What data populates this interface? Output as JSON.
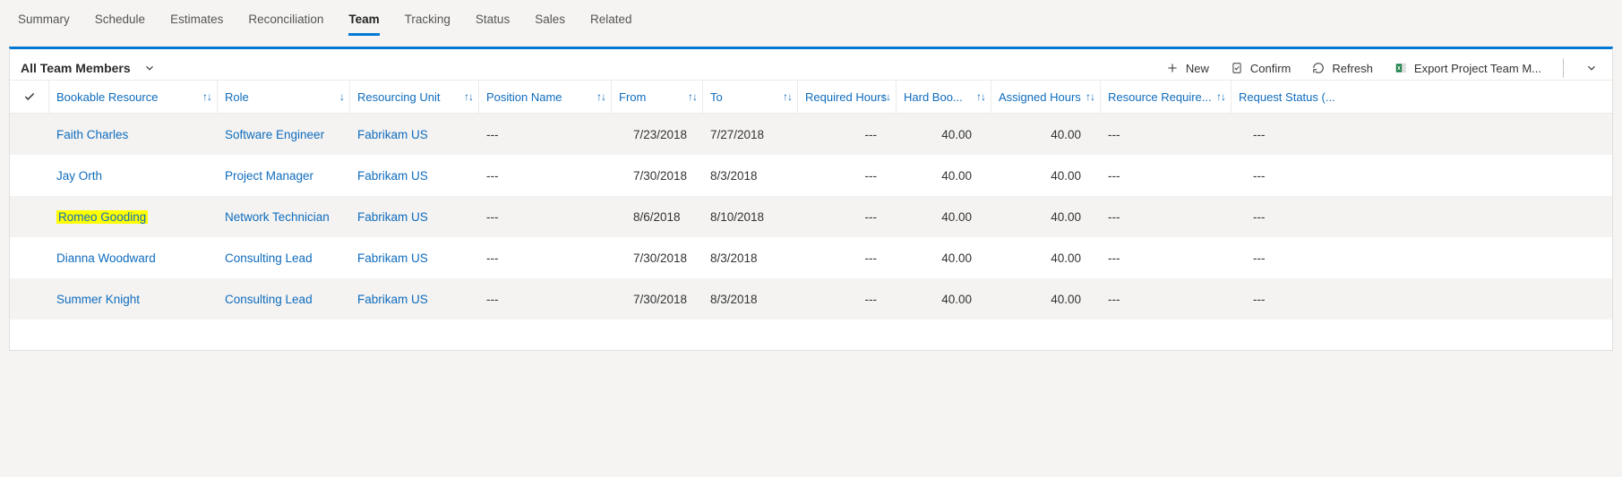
{
  "tabs": {
    "items": [
      {
        "label": "Summary"
      },
      {
        "label": "Schedule"
      },
      {
        "label": "Estimates"
      },
      {
        "label": "Reconciliation"
      },
      {
        "label": "Team"
      },
      {
        "label": "Tracking"
      },
      {
        "label": "Status"
      },
      {
        "label": "Sales"
      },
      {
        "label": "Related"
      }
    ],
    "active_index": 4
  },
  "view": {
    "name": "All Team Members"
  },
  "commands": {
    "new": "New",
    "confirm": "Confirm",
    "refresh": "Refresh",
    "export": "Export Project Team M..."
  },
  "columns": {
    "bookable_resource": "Bookable Resource",
    "role": "Role",
    "resourcing_unit": "Resourcing Unit",
    "position_name": "Position Name",
    "from": "From",
    "to": "To",
    "required_hours": "Required Hours",
    "hard_bookings": "Hard Boo...",
    "assigned_hours": "Assigned Hours",
    "resource_requirement": "Resource Require...",
    "request_status": "Request Status (..."
  },
  "rows": [
    {
      "resource": "Faith Charles",
      "role": "Software Engineer",
      "unit": "Fabrikam US",
      "position": "---",
      "from": "7/23/2018",
      "to": "7/27/2018",
      "required": "---",
      "hard": "40.00",
      "assigned": "40.00",
      "resreq": "---",
      "status": "---",
      "highlight": false,
      "alt": true
    },
    {
      "resource": "Jay Orth",
      "role": "Project Manager",
      "unit": "Fabrikam US",
      "position": "---",
      "from": "7/30/2018",
      "to": "8/3/2018",
      "required": "---",
      "hard": "40.00",
      "assigned": "40.00",
      "resreq": "---",
      "status": "---",
      "highlight": false,
      "alt": false
    },
    {
      "resource": "Romeo Gooding",
      "role": "Network Technician",
      "unit": "Fabrikam US",
      "position": "---",
      "from": "8/6/2018",
      "to": "8/10/2018",
      "required": "---",
      "hard": "40.00",
      "assigned": "40.00",
      "resreq": "---",
      "status": "---",
      "highlight": true,
      "alt": true
    },
    {
      "resource": "Dianna Woodward",
      "role": "Consulting Lead",
      "unit": "Fabrikam US",
      "position": "---",
      "from": "7/30/2018",
      "to": "8/3/2018",
      "required": "---",
      "hard": "40.00",
      "assigned": "40.00",
      "resreq": "---",
      "status": "---",
      "highlight": false,
      "alt": false
    },
    {
      "resource": "Summer Knight",
      "role": "Consulting Lead",
      "unit": "Fabrikam US",
      "position": "---",
      "from": "7/30/2018",
      "to": "8/3/2018",
      "required": "---",
      "hard": "40.00",
      "assigned": "40.00",
      "resreq": "---",
      "status": "---",
      "highlight": false,
      "alt": true
    }
  ]
}
